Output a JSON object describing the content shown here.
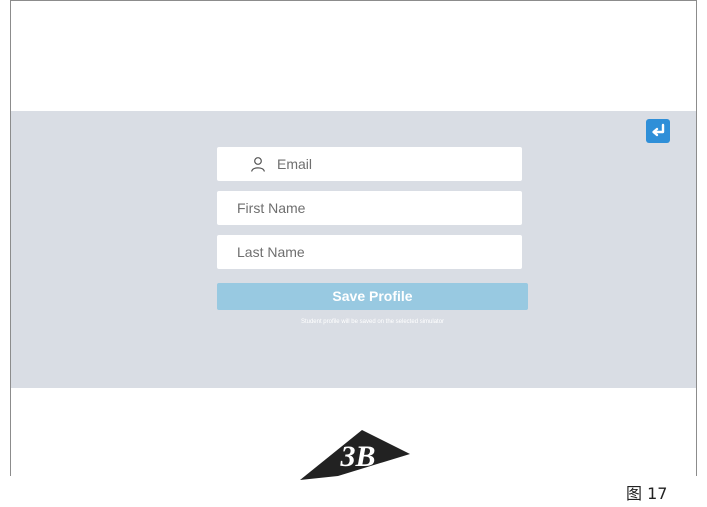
{
  "form": {
    "email": {
      "placeholder": "Email",
      "value": "",
      "icon": "user-icon"
    },
    "first_name": {
      "placeholder": "First Name",
      "value": ""
    },
    "last_name": {
      "placeholder": "Last Name",
      "value": ""
    },
    "save_label": "Save Profile",
    "note": "Student profile will be saved on the selected simulator"
  },
  "header": {
    "back_icon": "return-arrow-icon"
  },
  "logo": {
    "text": "3B"
  },
  "figure_label": "图 17",
  "colors": {
    "band_background": "#d9dde4",
    "save_button": "#98c9e1",
    "back_button": "#2f8fd8",
    "logo": "#222222"
  }
}
